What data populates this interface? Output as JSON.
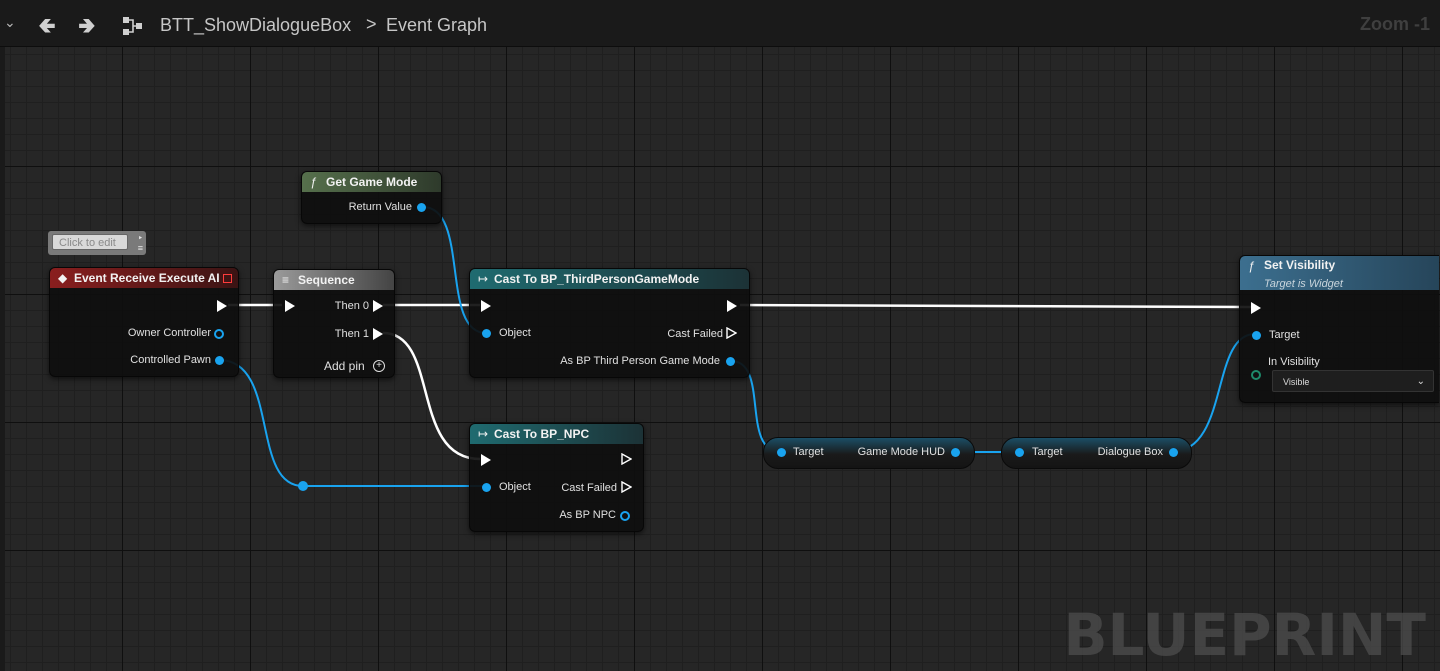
{
  "toolbar": {
    "menu_icon": "chevron-down-icon",
    "back_icon": "arrow-left-icon",
    "forward_icon": "arrow-right-icon",
    "graph_icon": "graph-hierarchy-icon",
    "breadcrumb_asset": "BTT_ShowDialogueBox",
    "breadcrumb_separator": ">",
    "breadcrumb_graph": "Event Graph",
    "zoom": "Zoom -1"
  },
  "comment": {
    "placeholder": "Click to edit"
  },
  "nodes": {
    "get_game_mode": {
      "title": "Get Game Mode",
      "output": "Return Value"
    },
    "event": {
      "title": "Event Receive Execute AI",
      "owner": "Owner Controller",
      "pawn": "Controlled Pawn"
    },
    "sequence": {
      "title": "Sequence",
      "then0": "Then 0",
      "then1": "Then 1",
      "add_pin": "Add pin"
    },
    "cast_gm": {
      "title": "Cast To BP_ThirdPersonGameMode",
      "object": "Object",
      "cast_failed": "Cast Failed",
      "as_output": "As BP Third Person Game Mode"
    },
    "cast_npc": {
      "title": "Cast To BP_NPC",
      "object": "Object",
      "cast_failed": "Cast Failed",
      "as_output": "As BP NPC"
    },
    "game_mode_hud": {
      "target": "Target",
      "output": "Game Mode HUD"
    },
    "dialogue_box": {
      "target": "Target",
      "output": "Dialogue Box"
    },
    "set_visibility": {
      "title": "Set Visibility",
      "subtitle": "Target is Widget",
      "target": "Target",
      "in_visibility": "In Visibility",
      "visibility_value": "Visible"
    }
  },
  "watermark": "BLUEPRINT",
  "colors": {
    "object_pin": "#19a3ef",
    "exec_wire": "#ffffff",
    "grid_bg": "#262626"
  }
}
